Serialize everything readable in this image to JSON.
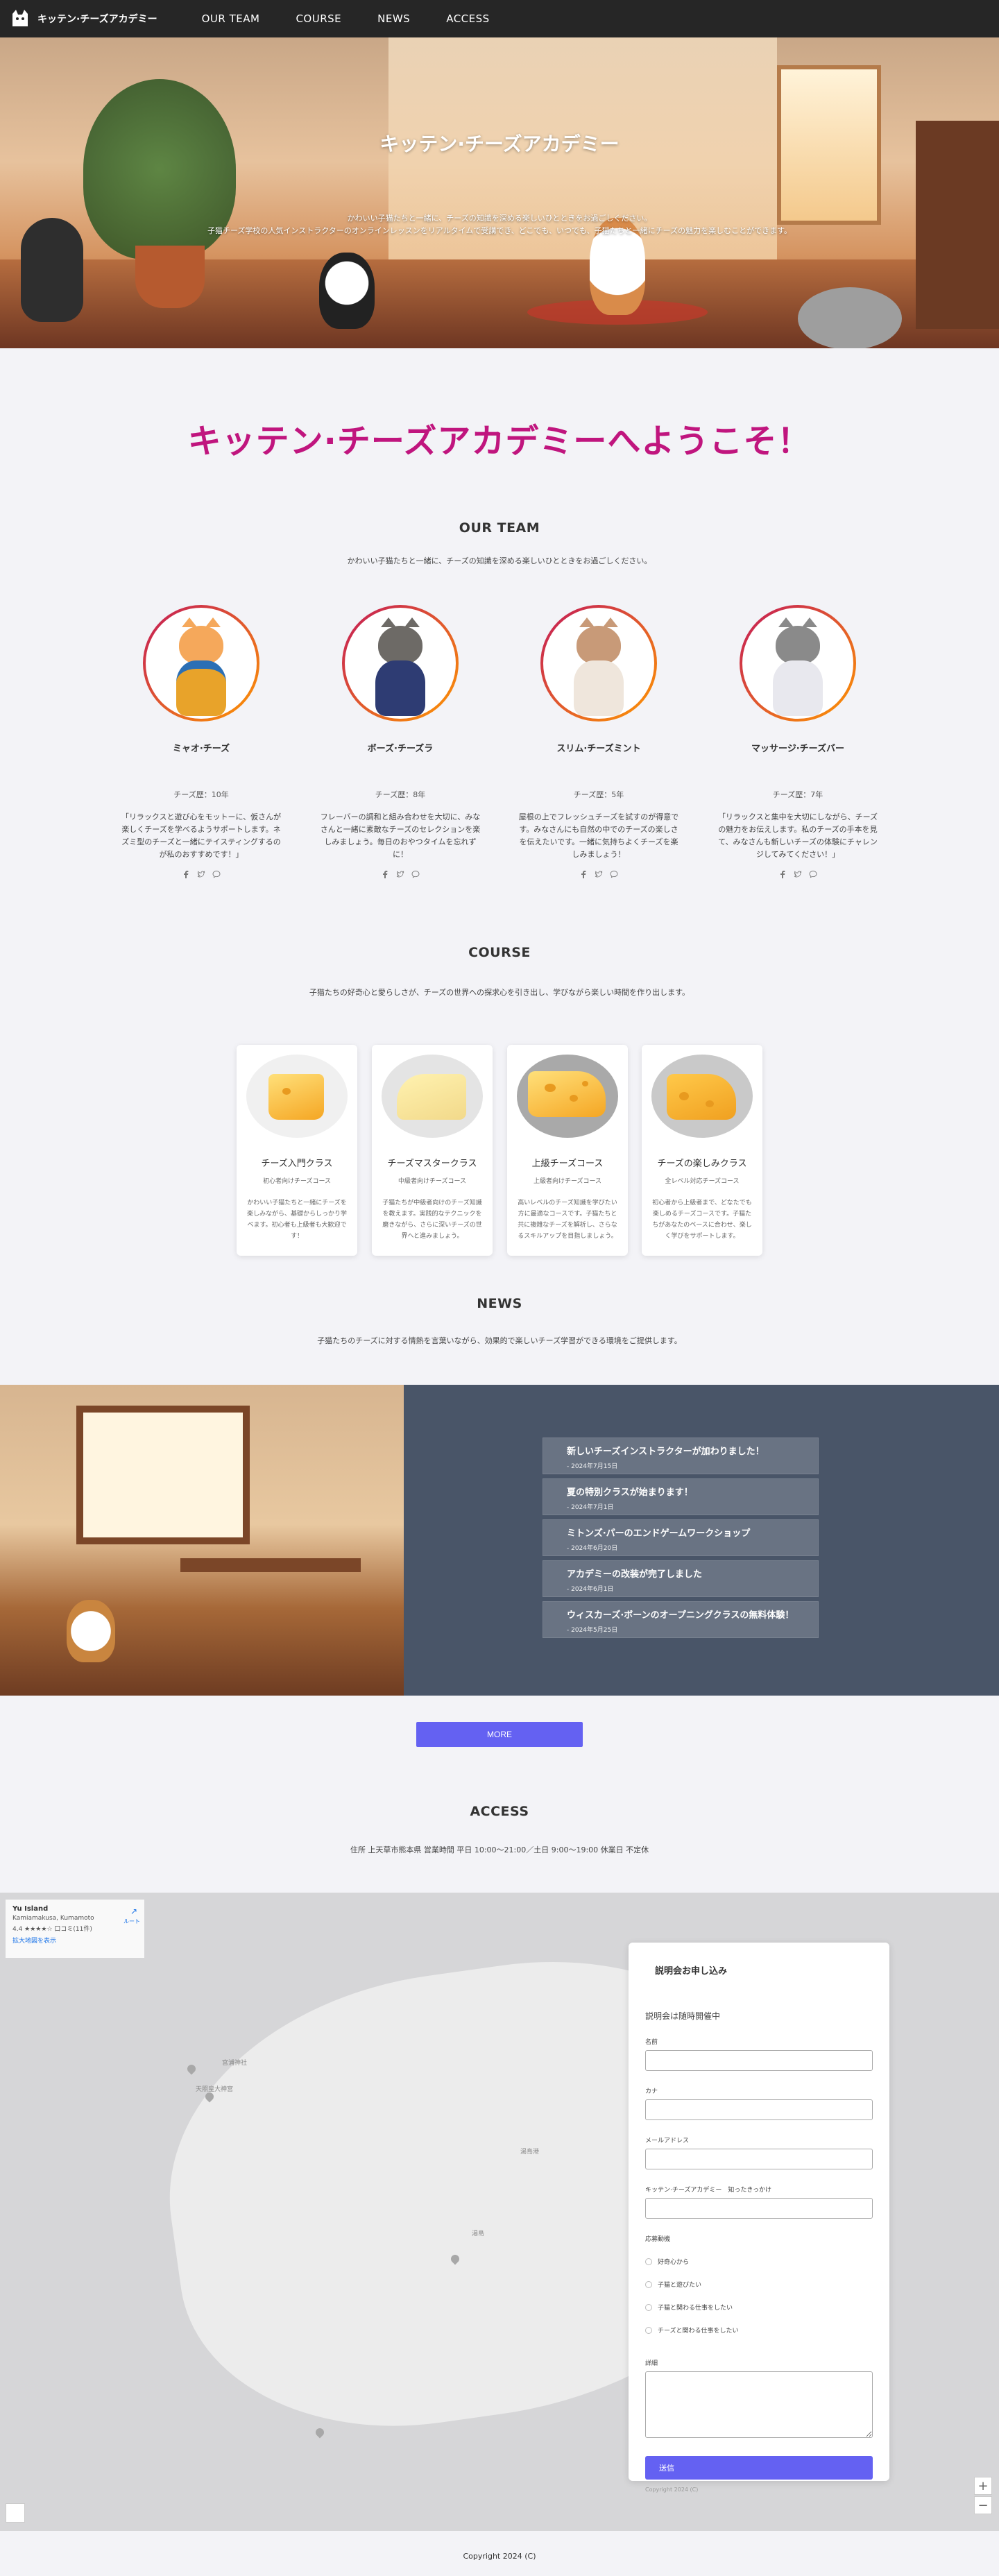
{
  "nav": {
    "brand": "キッテン·チーズアカデミー",
    "links": [
      "OUR TEAM",
      "COURSE",
      "NEWS",
      "ACCESS"
    ]
  },
  "hero": {
    "title": "キッテン·チーズアカデミー",
    "line1": "かわいい子猫たちと一緒に、チーズの知識を深める楽しいひとときをお過ごしください。",
    "line2": "子猫チーズ学校の人気インストラクターのオンラインレッスンをリアルタイムで受講でき、どこでも、いつでも、子猫たちと一緒にチーズの魅力を楽しむことができます。"
  },
  "welcome": "キッテン·チーズアカデミーへようこそ！",
  "team": {
    "title": "OUR TEAM",
    "desc": "かわいい子猫たちと一緒に、チーズの知識を深める楽しいひとときをお過ごしください。",
    "members": [
      {
        "name": "ミャオ·チーズ",
        "years": "チーズ歴：10年",
        "msg": "「リラックスと遊び心をモットーに、仮さんが楽しくチーズを学べるようサポートします。ネズミ型のチーズと一緒にテイスティングするのが私のおすすめです！」"
      },
      {
        "name": "ボーズ·チーズラ",
        "years": "チーズ歴：8年",
        "msg": "フレーバーの調和と組み合わせを大切に、みなさんと一緒に素敵なチーズのセレクションを楽しみましょう。毎日のおやつタイムを忘れずに！"
      },
      {
        "name": "スリム·チーズミント",
        "years": "チーズ歴：5年",
        "msg": "屋根の上でフレッシュチーズを試すのが得意です。みなさんにも自然の中でのチーズの楽しさを伝えたいです。一緒に気持ちよくチーズを楽しみましょう！"
      },
      {
        "name": "マッサージ·チーズバー",
        "years": "チーズ歴：7年",
        "msg": "「リラックスと集中を大切にしながら、チーズの魅力をお伝えします。私のチーズの手本を見て、みなさんも新しいチーズの体験にチャレンジしてみてください！」"
      }
    ]
  },
  "course": {
    "title": "COURSE",
    "desc": "子猫たちの好奇心と愛らしさが、チーズの世界への探求心を引き出し、学びながら楽しい時間を作り出します。",
    "cards": [
      {
        "title": "チーズ入門クラス",
        "sub": "初心者向けチーズコース",
        "desc": "かわいい子猫たちと一緒にチーズを楽しみながら、基礎からしっかり学べます。初心者も上級者も大歓迎です！",
        "bg": "#f0f0f0"
      },
      {
        "title": "チーズマスタークラス",
        "sub": "中級者向けチーズコース",
        "desc": "子猫たちが中級者向けのチーズ知識を教えます。実践的なテクニックを磨きながら、さらに深いチーズの世界へと進みましょう。",
        "bg": "#e4e4e4"
      },
      {
        "title": "上級チーズコース",
        "sub": "上級者向けチーズコース",
        "desc": "高いレベルのチーズ知識を学びたい方に最適なコースです。子猫たちと共に複雑なチーズを解析し、さらなるスキルアップを目指しましょう。",
        "bg": "#a9a9a9"
      },
      {
        "title": "チーズの楽しみクラス",
        "sub": "全レベル対応チーズコース",
        "desc": "初心者から上級者まで、どなたでも楽しめるチーズコースです。子猫たちがあなたのペースに合わせ、楽しく学びをサポートします。",
        "bg": "#c9c9c9"
      }
    ]
  },
  "news": {
    "title": "NEWS",
    "desc": "子猫たちのチーズに対する情熱を言葉いながら、効果的で楽しいチーズ学習ができる環境をご提供します。",
    "items": [
      {
        "title": "新しいチーズインストラクターが加わりました！",
        "date": "- 2024年7月15日"
      },
      {
        "title": "夏の特別クラスが始まります！",
        "date": "- 2024年7月1日"
      },
      {
        "title": "ミトンズ·パーのエンドゲームワークショップ",
        "date": "- 2024年6月20日"
      },
      {
        "title": "アカデミーの改装が完了しました",
        "date": "- 2024年6月1日"
      },
      {
        "title": "ウィスカーズ·ボーンのオープニングクラスの無料体験！",
        "date": "- 2024年5月25日"
      }
    ],
    "more": "MORE"
  },
  "access": {
    "title": "ACCESS",
    "info": "住所 上天草市熊本県 営業時間 平日 10:00～21:00／土日 9:00～19:00 休業日 不定休",
    "map": {
      "place": "Yu Island",
      "address": "Kamiamakusa, Kumamoto",
      "rating": "4.4 ★★★★☆",
      "reviews": "口コミ(11件)",
      "larger": "拡大地図を表示",
      "directions": "ルート",
      "zoom_in": "+",
      "zoom_out": "−",
      "labels": [
        "宮浦神社",
        "天照皇大神宮",
        "湯島",
        "湯島港"
      ]
    },
    "form": {
      "title": "説明会お申し込み",
      "subtitle": "説明会は随時開催中",
      "labels": [
        "名前",
        "カナ",
        "メールアドレス",
        "キッテン·チーズアカデミー　知ったきっかけ"
      ],
      "radio_label": "応募動機",
      "radios": [
        "好奇心から",
        "子猫と遊びたい",
        "子猫と関わる仕事をしたい",
        "チーズと関わる仕事をしたい"
      ],
      "textarea_label": "詳細",
      "submit": "送信",
      "copy": "Copyright 2024 (C)"
    }
  },
  "footer": "Copyright 2024 (C)",
  "colors": {
    "accent": "#c0157e",
    "button": "#6461f2",
    "news_panel": "#495568",
    "nav": "#262626"
  }
}
